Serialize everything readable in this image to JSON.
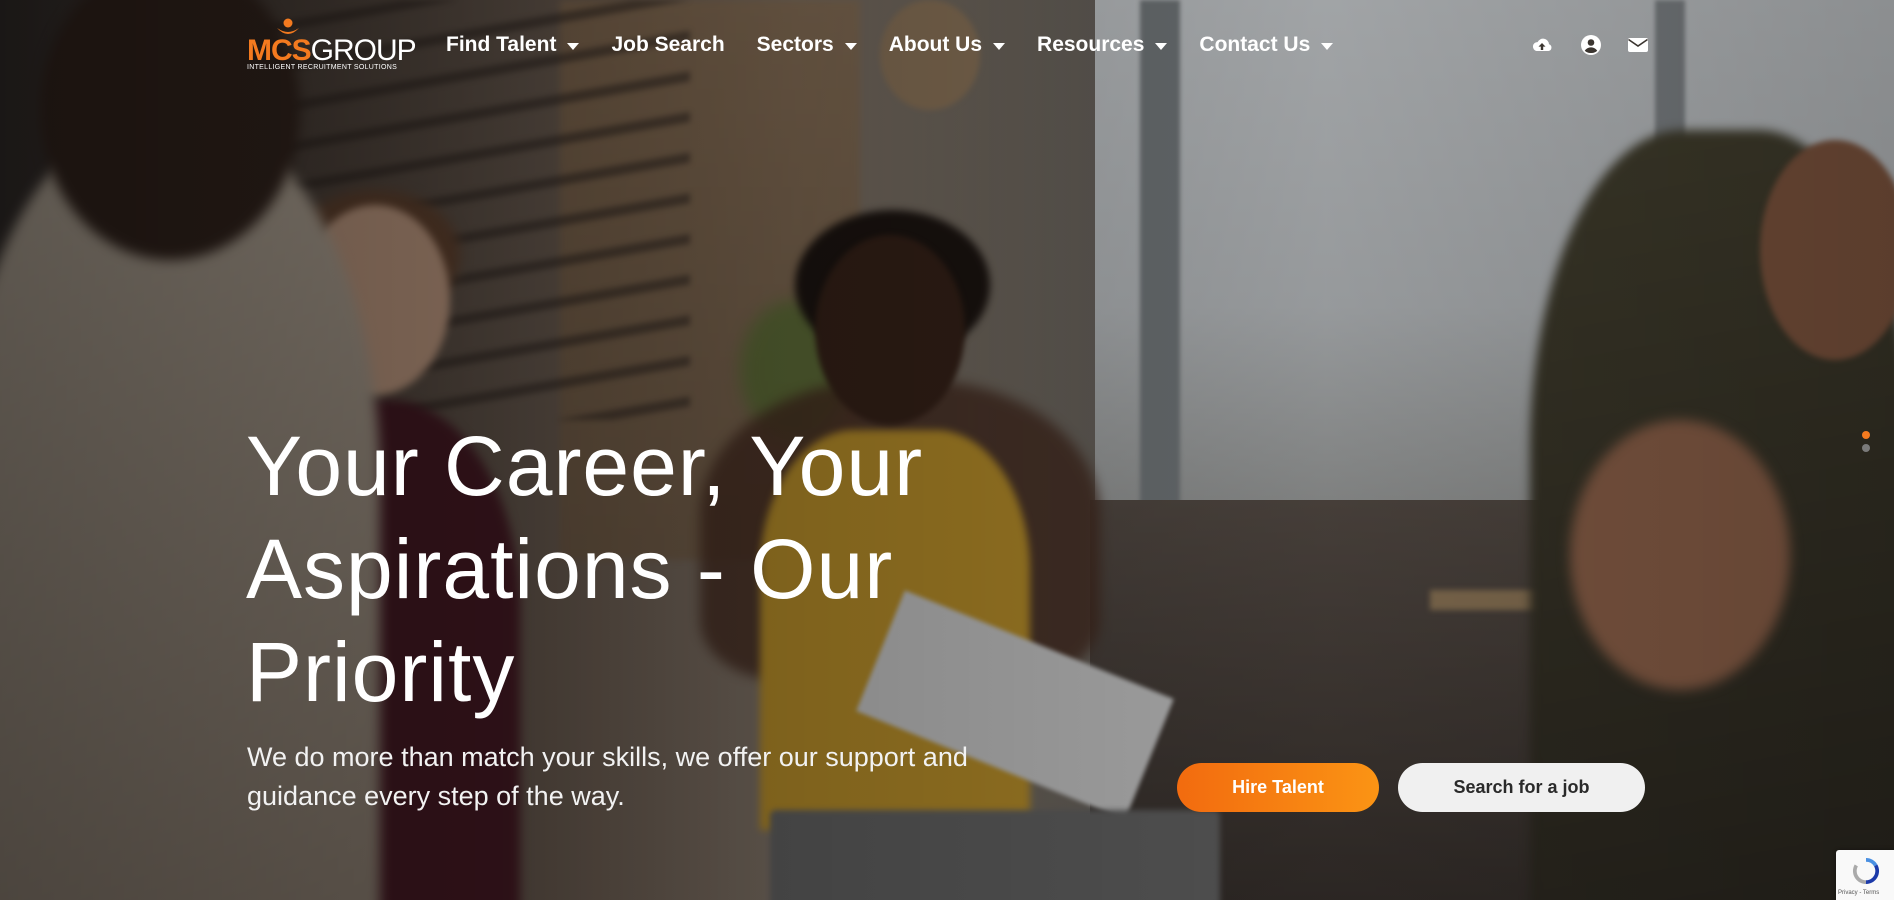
{
  "logo": {
    "brand_primary": "MCS",
    "brand_secondary": "GROUP",
    "tagline": "INTELLIGENT RECRUITMENT SOLUTIONS",
    "accent_color": "#f47a1f"
  },
  "nav": {
    "items": [
      {
        "label": "Find Talent",
        "has_dropdown": true
      },
      {
        "label": "Job Search",
        "has_dropdown": false
      },
      {
        "label": "Sectors",
        "has_dropdown": true
      },
      {
        "label": "About Us",
        "has_dropdown": true
      },
      {
        "label": "Resources",
        "has_dropdown": true
      },
      {
        "label": "Contact Us",
        "has_dropdown": true
      }
    ],
    "utility_icons": [
      "cloud-upload-icon",
      "user-account-icon",
      "envelope-icon"
    ]
  },
  "hero": {
    "title": "Your Career, Your Aspirations - Our Priority",
    "subtitle": "We do more than match your skills, we offer our support and guidance every step of the way.",
    "primary_button": "Hire Talent",
    "secondary_button": "Search for a job",
    "primary_color": "#f47a1f",
    "slider": {
      "total": 2,
      "active_index": 0
    }
  },
  "recaptcha": {
    "text": "Privacy - Terms"
  }
}
